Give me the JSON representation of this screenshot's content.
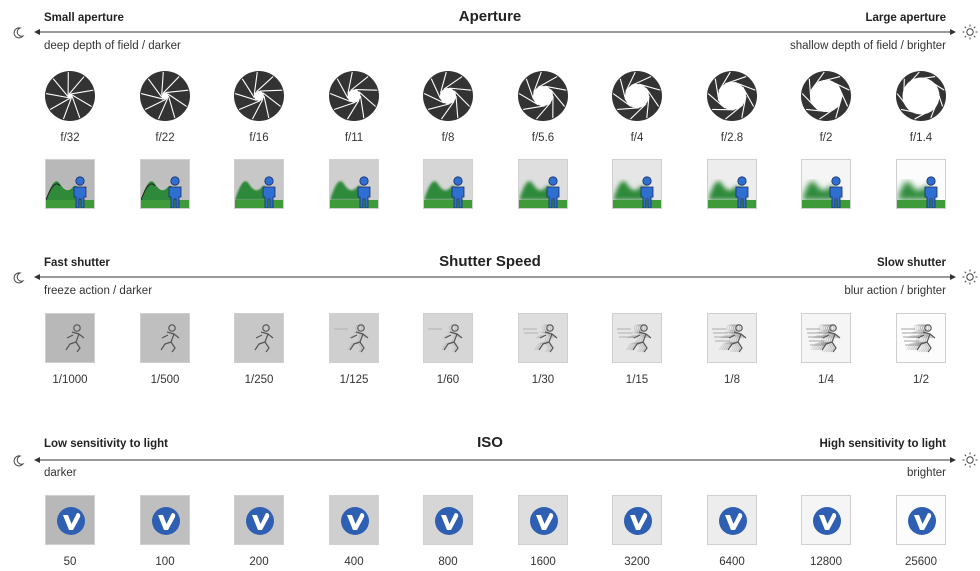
{
  "aperture": {
    "title": "Aperture",
    "left_title": "Small aperture",
    "right_title": "Large aperture",
    "left_sub": "deep depth of field / darker",
    "right_sub": "shallow depth of field / brighter",
    "stops": [
      "f/32",
      "f/22",
      "f/16",
      "f/11",
      "f/8",
      "f/5.6",
      "f/4",
      "f/2.8",
      "f/2",
      "f/1.4"
    ]
  },
  "shutter": {
    "title": "Shutter Speed",
    "left_title": "Fast shutter",
    "right_title": "Slow shutter",
    "left_sub": "freeze action / darker",
    "right_sub": "blur action / brighter",
    "speeds": [
      "1/1000",
      "1/500",
      "1/250",
      "1/125",
      "1/60",
      "1/30",
      "1/15",
      "1/8",
      "1/4",
      "1/2"
    ]
  },
  "iso": {
    "title": "ISO",
    "left_title": "Low sensitivity to light",
    "right_title": "High sensitivity to light",
    "left_sub": "darker",
    "right_sub": "brighter",
    "values": [
      "50",
      "100",
      "200",
      "400",
      "800",
      "1600",
      "3200",
      "6400",
      "12800",
      "25600"
    ]
  },
  "icons": {
    "left": "moon-icon",
    "right": "sun-icon",
    "iris": "aperture-iris-icon",
    "scene": "landscape-person-icon",
    "runner": "running-person-icon",
    "logo": "v-logo-icon"
  },
  "colors": {
    "text": "#222222",
    "person": "#2f6fd1",
    "grass": "#3f9a3a",
    "logo": "#2e5fb3",
    "iris_dark": "#333333"
  },
  "progression": {
    "iris_opening": [
      0.08,
      0.14,
      0.2,
      0.26,
      0.32,
      0.4,
      0.48,
      0.56,
      0.64,
      0.74
    ],
    "background_brightness": [
      0.72,
      0.75,
      0.78,
      0.81,
      0.84,
      0.87,
      0.9,
      0.93,
      0.96,
      0.99
    ],
    "motion_blur": [
      0,
      0,
      0,
      0.1,
      0.2,
      0.3,
      0.45,
      0.6,
      0.75,
      0.9
    ]
  }
}
